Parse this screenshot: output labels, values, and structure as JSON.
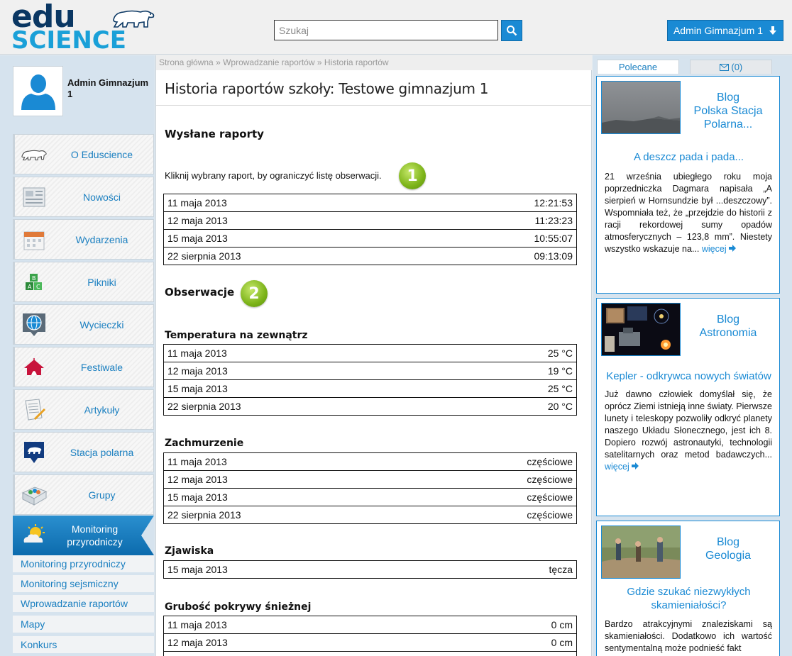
{
  "header": {
    "logo_top": "edu",
    "logo_bottom": "SCIENCE",
    "search_placeholder": "Szukaj",
    "user_button": "Admin Gimnazjum 1"
  },
  "sidebar": {
    "profile_name": "Admin Gimnazjum 1",
    "items": [
      {
        "label": "O Eduscience",
        "icon": "polar-bear-icon"
      },
      {
        "label": "Nowości",
        "icon": "newspaper-icon"
      },
      {
        "label": "Wydarzenia",
        "icon": "calendar-icon"
      },
      {
        "label": "Pikniki",
        "icon": "blocks-icon"
      },
      {
        "label": "Wycieczki",
        "icon": "globe-icon"
      },
      {
        "label": "Festiwale",
        "icon": "tent-icon"
      },
      {
        "label": "Artykuły",
        "icon": "document-icon"
      },
      {
        "label": "Stacja polarna",
        "icon": "polar-station-icon"
      },
      {
        "label": "Grupy",
        "icon": "groups-icon"
      }
    ],
    "active_item": {
      "label": "Monitoring przyrodniczy",
      "icon": "sun-cloud-icon"
    },
    "sub_items": [
      "Monitoring przyrodniczy",
      "Monitoring sejsmiczny",
      "Wprowadzanie raportów",
      "Mapy",
      "Konkurs"
    ]
  },
  "main": {
    "breadcrumb": [
      "Strona główna",
      "Wprowadzanie raportów",
      "Historia raportów"
    ],
    "breadcrumb_sep": "»",
    "title": "Historia raportów szkoły: Testowe gimnazjum 1",
    "sent_heading": "Wysłane raporty",
    "hint": "Kliknij wybrany raport, by ograniczyć listę obserwacji.",
    "badge1": "1",
    "badge2": "2",
    "reports": [
      {
        "date": "11 maja 2013",
        "time": "12:21:53"
      },
      {
        "date": "12 maja 2013",
        "time": "11:23:23"
      },
      {
        "date": "15 maja 2013",
        "time": "10:55:07"
      },
      {
        "date": "22 sierpnia 2013",
        "time": "09:13:09"
      }
    ],
    "observations_heading": "Obserwacje",
    "groups": [
      {
        "name": "Temperatura na zewnątrz",
        "rows": [
          {
            "date": "11 maja 2013",
            "value": "25 °C"
          },
          {
            "date": "12 maja 2013",
            "value": "19 °C"
          },
          {
            "date": "15 maja 2013",
            "value": "25 °C"
          },
          {
            "date": "22 sierpnia 2013",
            "value": "20 °C"
          }
        ]
      },
      {
        "name": "Zachmurzenie",
        "rows": [
          {
            "date": "11 maja 2013",
            "value": "częściowe"
          },
          {
            "date": "12 maja 2013",
            "value": "częściowe"
          },
          {
            "date": "15 maja 2013",
            "value": "częściowe"
          },
          {
            "date": "22 sierpnia 2013",
            "value": "częściowe"
          }
        ]
      },
      {
        "name": "Zjawiska",
        "rows": [
          {
            "date": "15 maja 2013",
            "value": "tęcza"
          }
        ]
      },
      {
        "name": "Grubość pokrywy śnieżnej",
        "rows": [
          {
            "date": "11 maja 2013",
            "value": "0 cm"
          },
          {
            "date": "12 maja 2013",
            "value": "0 cm"
          }
        ]
      }
    ]
  },
  "right": {
    "tabs": {
      "recommended": "Polecane",
      "messages": "(0)"
    },
    "cards": [
      {
        "blog": "Blog\nPolska Stacja Polarna...",
        "blog_line1": "Blog",
        "blog_line2": "Polska Stacja Polarna...",
        "title": "A deszcz pada i pada...",
        "text": "21 września ubiegłego roku moja poprzedniczka Dagmara napisała „A sierpień w Hornsundzie był ...deszczowy”. Wspomniała też, że „przejdzie do historii z racji rekordowej sumy opadów atmosferycznych – 123,8 mm”. Niestety wszystko wskazuje na...",
        "more": "więcej"
      },
      {
        "blog_line1": "Blog",
        "blog_line2": "Astronomia",
        "title": "Kepler - odkrywca nowych światów",
        "text": "Już dawno człowiek domyślał się, że oprócz Ziemi istnieją inne światy. Pierwsze lunety i teleskopy pozwoliły odkryć planety naszego Układu Słonecznego, jest ich 8. Dopiero rozwój astronautyki, technologii satelitarnych oraz metod badawczych...",
        "more": "więcej"
      },
      {
        "blog_line1": "Blog",
        "blog_line2": "Geologia",
        "title": "Gdzie szukać niezwykłych skamieniałości?",
        "text": "Bardzo atrakcyjnymi znaleziskami są skamieniałości. Dodatkowo ich wartość sentymentalną może podnieść fakt",
        "more": ""
      }
    ]
  },
  "colors": {
    "accent": "#1a8ad4",
    "navy": "#0a3763",
    "badge": "#7cb319"
  }
}
